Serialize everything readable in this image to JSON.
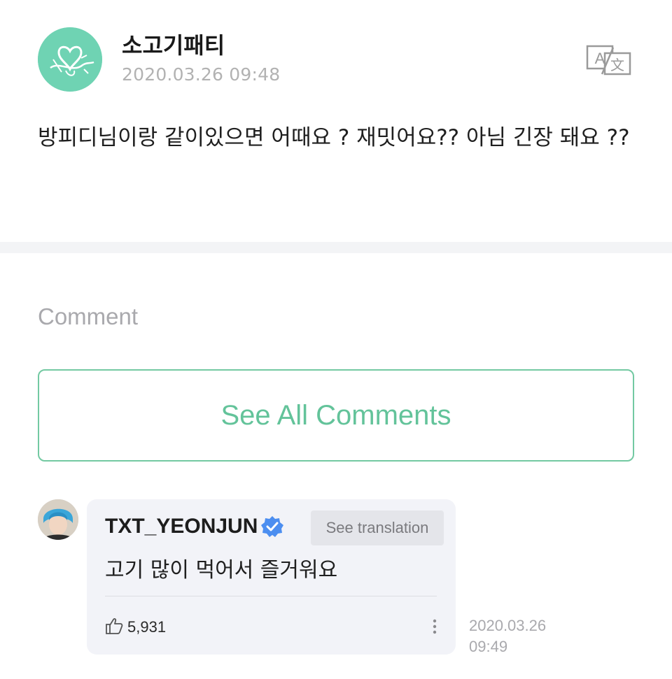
{
  "post": {
    "author": "소고기패티",
    "timestamp": "2020.03.26 09:48",
    "body": "방피디님이랑 같이있으면 어때요 ? 재밋어요?? 아님 긴장 돼요 ??",
    "translate_icon": "translate-icon",
    "avatar_color": "#6fd3b3"
  },
  "comments_section": {
    "heading": "Comment",
    "see_all_label": "See All Comments",
    "accent_color": "#63c39a"
  },
  "comment": {
    "author": "TXT_YEONJUN",
    "verified_icon": "verified-badge-icon",
    "see_translation_label": "See translation",
    "text": "고기 많이 먹어서 즐거워요",
    "like_icon": "thumbs-up-icon",
    "likes": "5,931",
    "more_icon": "more-vertical-icon",
    "date": "2020.03.26",
    "time": "09:49"
  }
}
